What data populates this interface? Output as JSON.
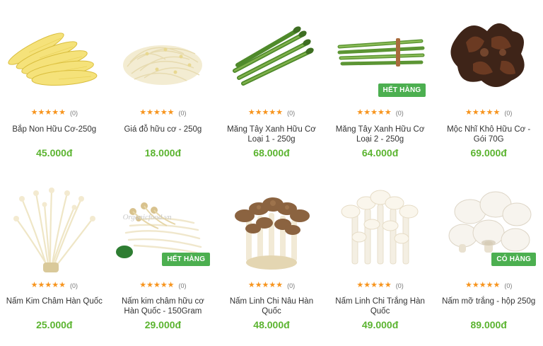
{
  "rating_stars": "★★★★★",
  "colors": {
    "price": "#5bb430",
    "star": "#f7941d",
    "badge": "#4caf50"
  },
  "products": [
    {
      "name": "Bắp Non Hữu Cơ-250g",
      "price": "45.000đ",
      "reviews": "(0)",
      "badge": "",
      "image_icon": "baby-corn-icon"
    },
    {
      "name": "Giá đỗ hữu cơ - 250g",
      "price": "18.000đ",
      "reviews": "(0)",
      "badge": "",
      "image_icon": "bean-sprouts-icon"
    },
    {
      "name": "Măng Tây Xanh Hữu Cơ Loại 1 - 250g",
      "price": "68.000đ",
      "reviews": "(0)",
      "badge": "",
      "image_icon": "asparagus-icon"
    },
    {
      "name": "Măng Tây Xanh Hữu Cơ Loại 2 - 250g",
      "price": "64.000đ",
      "reviews": "(0)",
      "badge": "HẾT HÀNG",
      "image_icon": "asparagus-bundle-icon"
    },
    {
      "name": "Mộc Nhĩ Khô Hữu Cơ - Gói 70G",
      "price": "69.000đ",
      "reviews": "(0)",
      "badge": "",
      "image_icon": "dried-wood-ear-icon"
    },
    {
      "name": "Nấm Kim Châm Hàn Quốc",
      "price": "25.000đ",
      "reviews": "(0)",
      "badge": "",
      "image_icon": "enoki-mushroom-icon"
    },
    {
      "name": "Nấm kim châm hữu cơ Hàn Quốc - 150Gram",
      "price": "29.000đ",
      "reviews": "(0)",
      "badge": "HẾT HÀNG",
      "image_icon": "enoki-organic-icon",
      "watermark": "Organicfood.vn"
    },
    {
      "name": "Nấm Linh Chi Nâu Hàn Quốc",
      "price": "48.000đ",
      "reviews": "(0)",
      "badge": "",
      "image_icon": "brown-beech-mushroom-icon"
    },
    {
      "name": "Nấm Linh Chi Trắng Hàn Quốc",
      "price": "49.000đ",
      "reviews": "(0)",
      "badge": "",
      "image_icon": "white-beech-mushroom-icon"
    },
    {
      "name": "Nấm mỡ trắng - hộp 250g",
      "price": "89.000đ",
      "reviews": "(0)",
      "badge": "CÓ HÀNG",
      "image_icon": "button-mushroom-icon"
    }
  ]
}
